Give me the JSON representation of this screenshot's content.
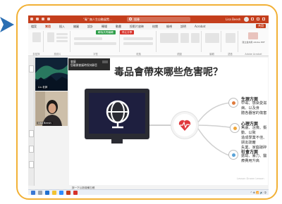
{
  "colors": {
    "frame_border": "#f2b136",
    "arrow": "#2b6fb3",
    "titlebar": "#c43e1c",
    "share_button": "#c43e1c",
    "green_button": "#2e9e49",
    "red_button": "#d7322a",
    "heart": "#e0393e",
    "node_liver": "#e07b3c",
    "node_mind": "#f0a63a",
    "node_social": "#5aa3d8"
  },
  "titlebar": {
    "doc_name": "\"毒\" 無人生自動展覽...",
    "search_placeholder": "搜尋",
    "user": "Lisa Beesh"
  },
  "ribbon_tabs": [
    "檔案",
    "常用",
    "插入",
    "繪圖",
    "設計",
    "轉場",
    "動畫",
    "投影片放映",
    "校閱",
    "檢視",
    "說明",
    "Acrobat"
  ],
  "share_label": "共用",
  "ribbon": {
    "green_button": "轉為共同編輯",
    "red_button": "停止分享",
    "group_labels": [
      "剪貼簿",
      "投影片",
      "字型",
      "段落",
      "繪圖",
      "編輯",
      "語音",
      "Adobe Acrobat"
    ],
    "acrobat_label": "建立並共用 Adobe PDF"
  },
  "popup": {
    "title": "會議",
    "text": "您離開會議時保持靜音"
  },
  "participants": [
    {
      "name": "Liu 老師",
      "icon": "aurora-background"
    },
    {
      "name": "Lisa Beesh",
      "icon": "person-video"
    }
  ],
  "slide": {
    "title": "毒品會帶來哪些危害呢？",
    "sections": [
      {
        "heading": "生理方面",
        "text": "中毒、感染愛滋病、以及身\n體各器官的傷害",
        "icon": "liver-icon"
      },
      {
        "heading": "心理方面",
        "text": "焦慮、沮喪、衝動、以致\n造成學業不佳、朋友疏離\n失業、家庭破碎",
        "icon": "brain-icon"
      },
      {
        "heading": "社會方面",
        "text": "搶劫、暴力、醫療費用升高",
        "icon": "people-icon"
      }
    ],
    "watermark": "Lesson Drawn Lesson"
  },
  "notes_placeholder": "按一下以新增備忘稿",
  "statusbar": {
    "left": "投影片 3 / 5   中文(台灣)   協助工具: 調查",
    "right": "備忘稿   檢視"
  },
  "taskbar": {
    "tray_text": "^ ⊕ 📶 🔊 中"
  }
}
